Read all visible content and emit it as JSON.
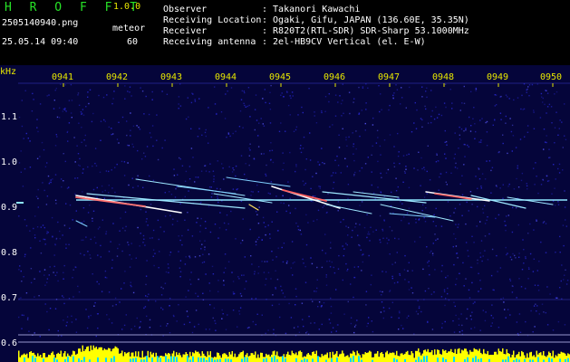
{
  "app": {
    "title": "H R O F F T",
    "version": "1.0.0"
  },
  "file": {
    "filename": "2505140940.png",
    "timestamp": "25.05.14 09:40",
    "count_label": "meteor",
    "count_value": "60"
  },
  "info": [
    {
      "label": "Observer",
      "value": ": Takanori Kawachi"
    },
    {
      "label": "Receiving Location",
      "value": ": Ogaki, Gifu, JAPAN (136.60E, 35.35N)"
    },
    {
      "label": "Receiver",
      "value": ": R820T2(RTL-SDR) SDR-Sharp 53.1000MHz"
    },
    {
      "label": "Receiving antenna",
      "value": ": 2el-HB9CV Vertical (el. E-W)"
    }
  ],
  "axis": {
    "y_unit": "kHz",
    "x_ticks": [
      "0941",
      "0942",
      "0943",
      "0944",
      "0945",
      "0946",
      "0947",
      "0948",
      "0949",
      "0950"
    ],
    "y_ticks": [
      "1.1",
      "1.0",
      "0.9",
      "0.8",
      "0.7",
      "0.6"
    ]
  },
  "colors": {
    "background": "#05053a",
    "noise": "#2a2ad8",
    "header_green": "#27e327",
    "tick_yellow": "#e8e800",
    "carrier": "#8ee6ff",
    "level_yellow": "#ffff00",
    "level_cyan": "#00d8ff"
  }
}
